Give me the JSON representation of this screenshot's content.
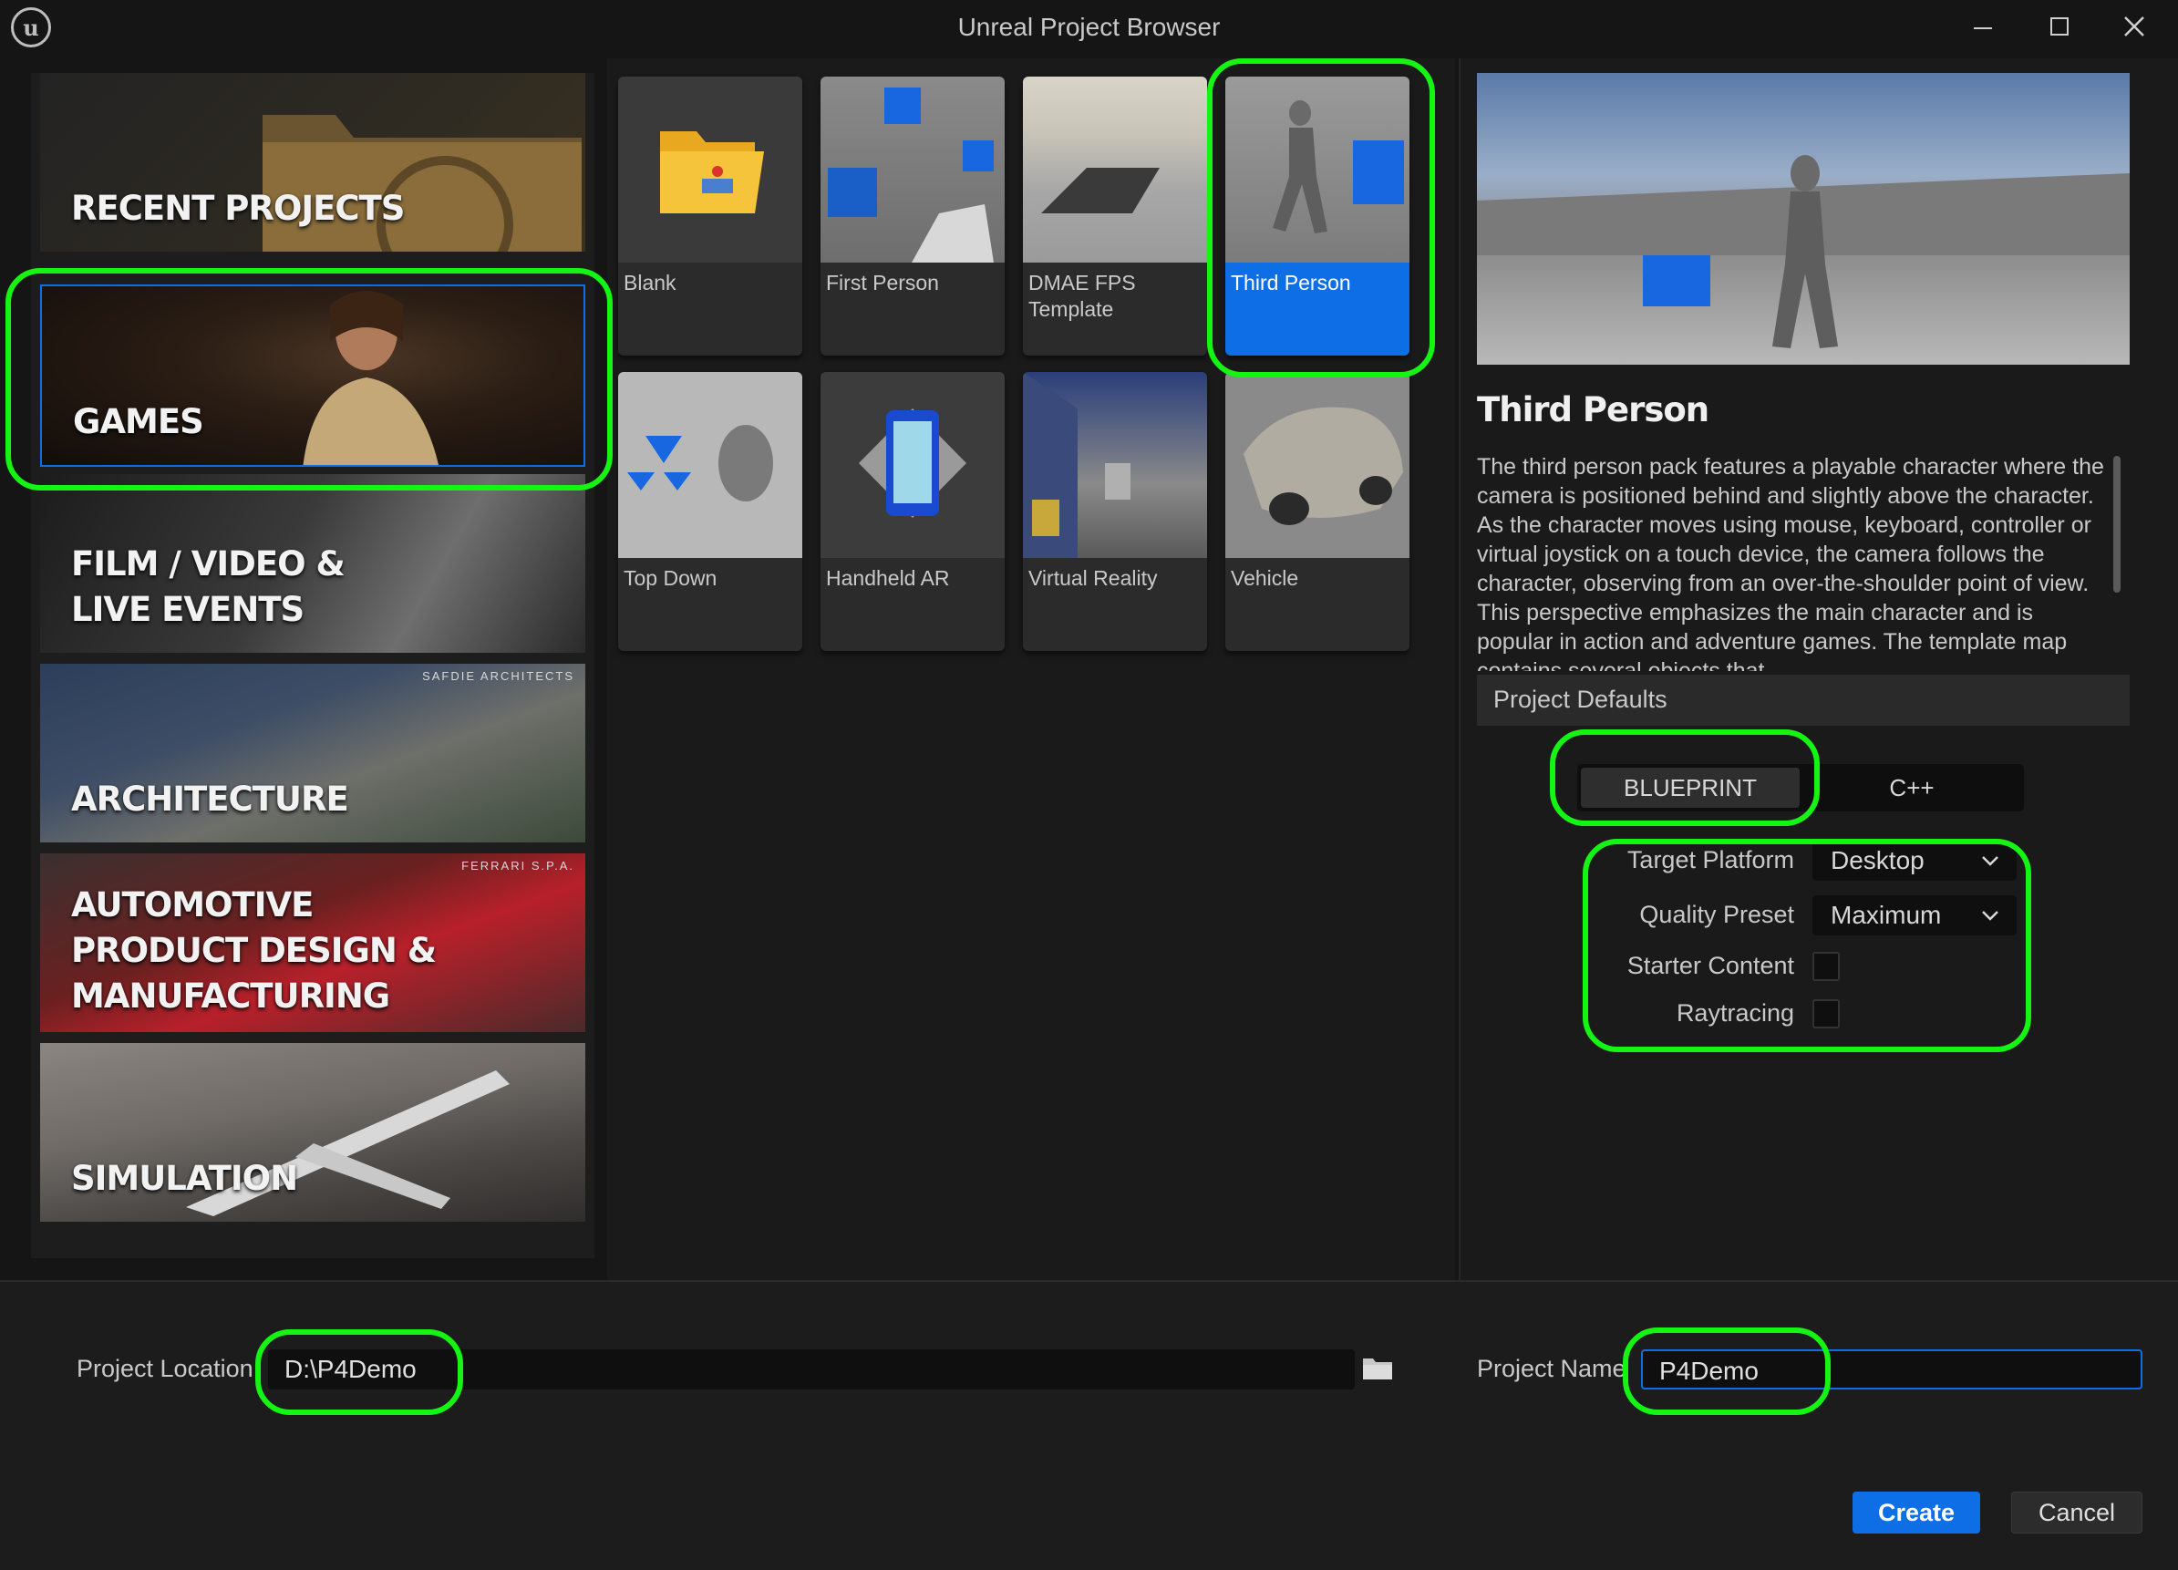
{
  "window": {
    "title": "Unreal Project Browser",
    "minimize_glyph": "—",
    "maximize_glyph": "☐",
    "close_glyph": "✕",
    "logo_text": "u"
  },
  "categories": [
    {
      "label": "RECENT PROJECTS",
      "credit": ""
    },
    {
      "label": "GAMES",
      "credit": ""
    },
    {
      "label": "FILM / VIDEO &\nLIVE EVENTS",
      "credit": ""
    },
    {
      "label": "ARCHITECTURE",
      "credit": "SAFDIE ARCHITECTS"
    },
    {
      "label": "AUTOMOTIVE\nPRODUCT DESIGN &\nMANUFACTURING",
      "credit": "FERRARI S.P.A."
    },
    {
      "label": "SIMULATION",
      "credit": ""
    }
  ],
  "templates": [
    {
      "label": "Blank"
    },
    {
      "label": "First Person"
    },
    {
      "label": "DMAE FPS\nTemplate"
    },
    {
      "label": "Third Person"
    },
    {
      "label": "Top Down"
    },
    {
      "label": "Handheld AR"
    },
    {
      "label": "Virtual Reality"
    },
    {
      "label": "Vehicle"
    }
  ],
  "selected_template": "Third Person",
  "details": {
    "title": "Third Person",
    "description": "The third person pack features a playable character where the camera is positioned behind and slightly above the character. As the character moves using mouse, keyboard, controller or virtual joystick on a touch device, the camera follows the character, observing from an over-the-shoulder point of view. This perspective emphasizes the main character and is popular in action and adventure games. The template map contains several objects that"
  },
  "project_defaults": {
    "header": "Project Defaults",
    "language_options": [
      "BLUEPRINT",
      "C++"
    ],
    "selected_language": "BLUEPRINT",
    "target_platform_label": "Target Platform",
    "target_platform_value": "Desktop",
    "quality_preset_label": "Quality Preset",
    "quality_preset_value": "Maximum",
    "starter_content_label": "Starter Content",
    "starter_content_checked": false,
    "raytracing_label": "Raytracing",
    "raytracing_checked": false
  },
  "bottom": {
    "project_location_label": "Project Location",
    "project_location_value": "D:\\P4Demo",
    "project_name_label": "Project Name",
    "project_name_value": "P4Demo",
    "create_label": "Create",
    "cancel_label": "Cancel"
  },
  "colors": {
    "accent": "#0e6ee6",
    "highlight": "#14f514",
    "background": "#151515"
  }
}
